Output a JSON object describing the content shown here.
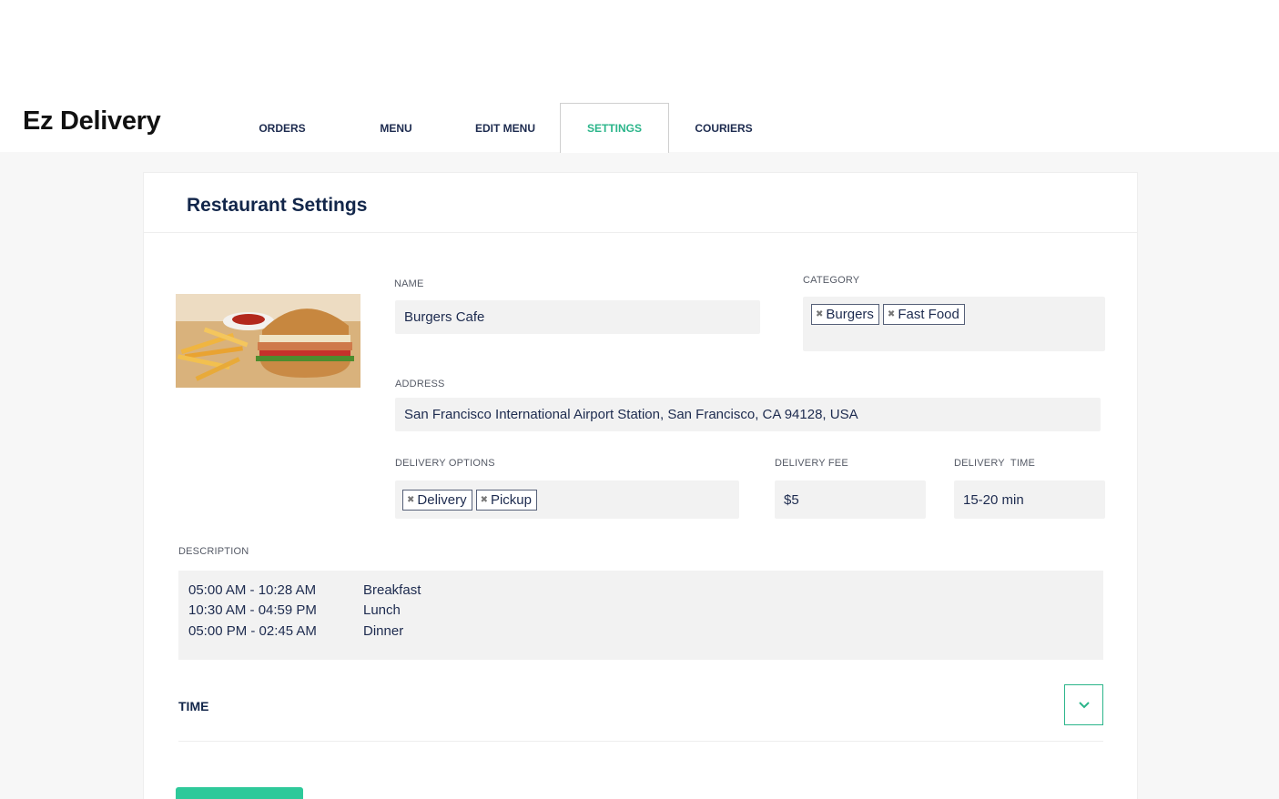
{
  "app": {
    "title": "Ez Delivery"
  },
  "nav": {
    "items": [
      {
        "label": "ORDERS"
      },
      {
        "label": "MENU"
      },
      {
        "label": "EDIT MENU"
      },
      {
        "label": "SETTINGS"
      },
      {
        "label": "COURIERS"
      }
    ],
    "active": "SETTINGS"
  },
  "page": {
    "title": "Restaurant Settings"
  },
  "form": {
    "name": {
      "label": "NAME",
      "value": "Burgers Cafe"
    },
    "category": {
      "label": "CATEGORY",
      "tags": [
        "Burgers",
        "Fast Food"
      ]
    },
    "address": {
      "label": "ADDRESS",
      "value": "San Francisco International Airport Station, San Francisco, CA 94128, USA"
    },
    "delivery_options": {
      "label": "DELIVERY OPTIONS",
      "tags": [
        "Delivery",
        "Pickup"
      ]
    },
    "delivery_fee": {
      "label": "DELIVERY FEE",
      "value": "$5"
    },
    "delivery_time": {
      "label": "DELIVERY  TIME",
      "value": "15-20 min"
    },
    "description": {
      "label": "DESCRIPTION",
      "rows": [
        {
          "time": "05:00 AM - 10:28 AM",
          "meal": "Breakfast"
        },
        {
          "time": "10:30 AM - 04:59 PM",
          "meal": "Lunch"
        },
        {
          "time": "05:00 PM - 02:45 AM",
          "meal": "Dinner"
        }
      ]
    },
    "time": {
      "label": "TIME"
    }
  },
  "colors": {
    "accent": "#2bb58a",
    "title": "#12264a",
    "field_bg": "#f2f2f2",
    "page_bg": "#f7f7f7"
  },
  "icons": {
    "tag_remove": "close-icon",
    "expand": "chevron-down-icon"
  }
}
